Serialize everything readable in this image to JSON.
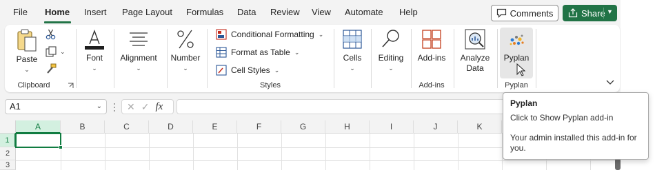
{
  "tabs": [
    {
      "label": "File"
    },
    {
      "label": "Home"
    },
    {
      "label": "Insert"
    },
    {
      "label": "Page Layout"
    },
    {
      "label": "Formulas"
    },
    {
      "label": "Data"
    },
    {
      "label": "Review"
    },
    {
      "label": "View"
    },
    {
      "label": "Automate"
    },
    {
      "label": "Help"
    }
  ],
  "header": {
    "comments_label": "Comments",
    "share_label": "Share"
  },
  "ribbon": {
    "clipboard": {
      "paste_label": "Paste",
      "group_label": "Clipboard"
    },
    "font": {
      "label": "Font"
    },
    "alignment": {
      "label": "Alignment"
    },
    "number": {
      "label": "Number"
    },
    "styles": {
      "conditional_formatting": "Conditional Formatting",
      "format_as_table": "Format as Table",
      "cell_styles": "Cell Styles",
      "group_label": "Styles"
    },
    "cells": {
      "label": "Cells"
    },
    "editing": {
      "label": "Editing"
    },
    "addins": {
      "label": "Add-ins",
      "group_label": "Add-ins"
    },
    "analyze": {
      "label1": "Analyze",
      "label2": "Data"
    },
    "pyplan": {
      "label": "Pyplan",
      "group_label": "Pyplan"
    }
  },
  "formula_bar": {
    "name_box": "A1",
    "fx": "fx",
    "value": ""
  },
  "columns": [
    "A",
    "B",
    "C",
    "D",
    "E",
    "F",
    "G",
    "H",
    "I",
    "J",
    "K"
  ],
  "rows": [
    "1",
    "2",
    "3"
  ],
  "tooltip": {
    "title": "Pyplan",
    "line1": "Click to Show Pyplan add-in",
    "line2": "Your admin installed this add-in for you."
  },
  "colors": {
    "accent": "#217346",
    "selection": "#107c41"
  }
}
